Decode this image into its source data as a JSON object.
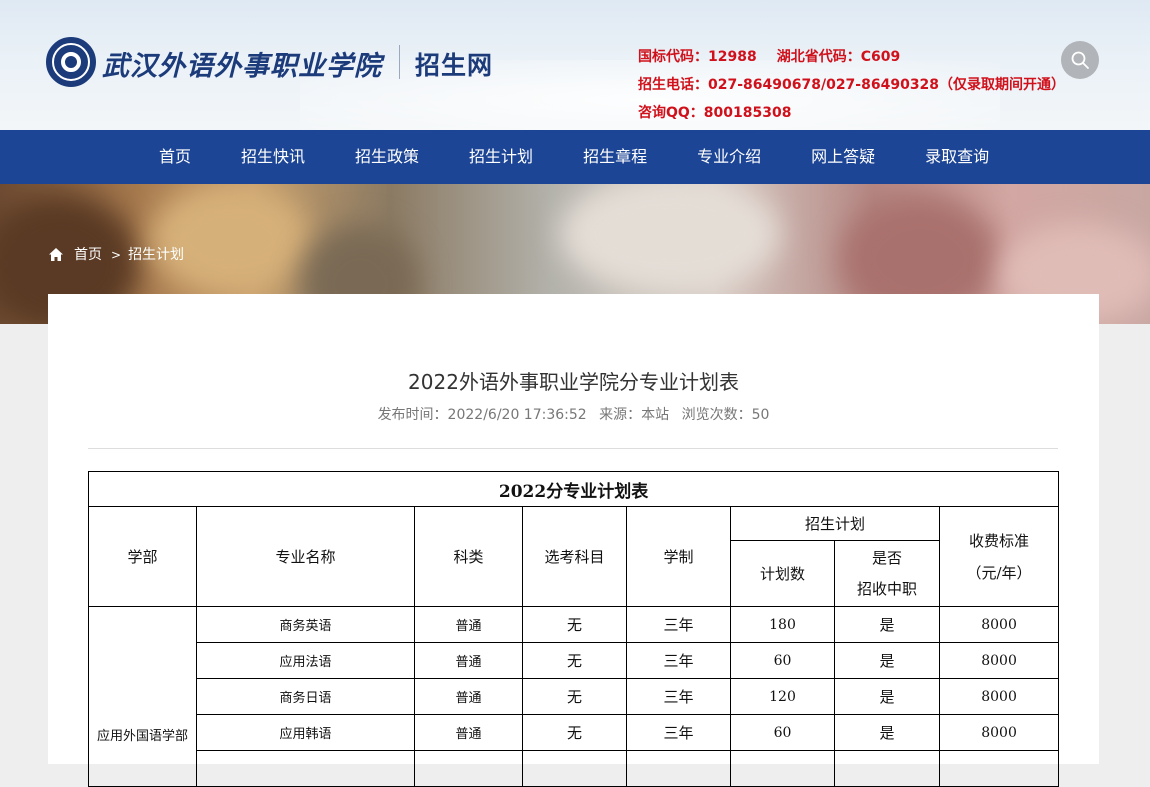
{
  "header": {
    "school_name": "武汉外语外事职业学院",
    "site_name": "招生网",
    "contact": {
      "national_code": "国标代码：12988",
      "province_code": "湖北省代码：C609",
      "phone": "招生电话：027-86490678/027-86490328（仅录取期间开通）",
      "qq": "咨询QQ：800185308"
    },
    "search_icon": "search-icon"
  },
  "nav": {
    "items": [
      "首页",
      "招生快讯",
      "招生政策",
      "招生计划",
      "招生章程",
      "专业介绍",
      "网上答疑",
      "录取查询"
    ]
  },
  "breadcrumb": {
    "home": "首页",
    "separator": ">",
    "current": "招生计划"
  },
  "article": {
    "title": "2022外语外事职业学院分专业计划表",
    "meta": {
      "published": "发布时间：2022/6/20 17:36:52",
      "source": "来源：本站",
      "views": "浏览次数：50"
    }
  },
  "table": {
    "caption": "2022分专业计划表",
    "headers": {
      "department": "学部",
      "major": "专业名称",
      "category": "科类",
      "subjects": "选考科目",
      "duration": "学制",
      "plan_group": "招生计划",
      "plan_count": "计划数",
      "vocational_line1": "是否",
      "vocational_line2": "招收中职",
      "fee_line1": "收费标准",
      "fee_line2": "（元/年）"
    },
    "department_name": "应用外国语学部",
    "rows": [
      {
        "major": "商务英语",
        "category": "普通",
        "subjects": "无",
        "duration": "三年",
        "plan": "180",
        "vocational": "是",
        "fee": "8000"
      },
      {
        "major": "应用法语",
        "category": "普通",
        "subjects": "无",
        "duration": "三年",
        "plan": "60",
        "vocational": "是",
        "fee": "8000"
      },
      {
        "major": "商务日语",
        "category": "普通",
        "subjects": "无",
        "duration": "三年",
        "plan": "120",
        "vocational": "是",
        "fee": "8000"
      },
      {
        "major": "应用韩语",
        "category": "普通",
        "subjects": "无",
        "duration": "三年",
        "plan": "60",
        "vocational": "是",
        "fee": "8000"
      }
    ]
  },
  "colors": {
    "nav_bg": "#1d4596",
    "brand_blue": "#1c3b7a",
    "contact_red": "#d0111b"
  }
}
